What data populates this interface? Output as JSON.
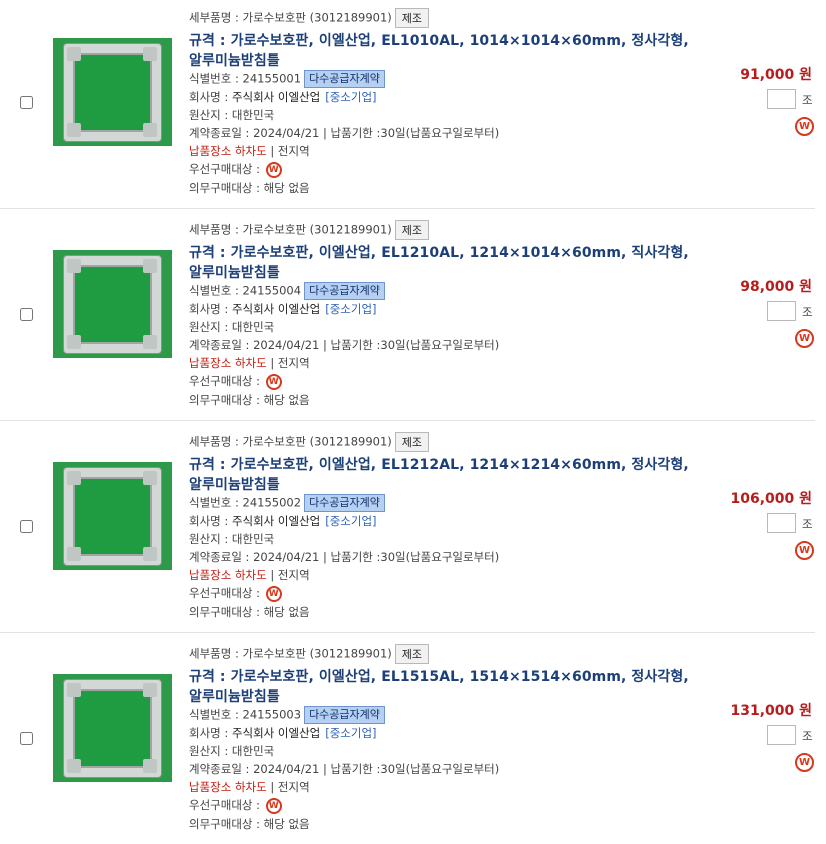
{
  "labels": {
    "sub_category": "세부품명 : 가로수보호판 (3012189901)",
    "mfr_badge": "제조",
    "id_prefix": "식별번호 : ",
    "multi_badge": "다수공급자계약",
    "company_prefix": "회사명 : ",
    "origin": "원산지 : 대한민국",
    "contract": "계약종료일 : 2024/04/21 | 납품기한 :30일(납품요구일로부터)",
    "delivery_place": "납품장소 하차도",
    "delivery_region": " | 전지역",
    "priority": "우선구매대상 : ",
    "mandatory": "의무구매대상 : 해당 없음",
    "qty_unit": "조",
    "w_mark": "W"
  },
  "items": [
    {
      "title": "규격 : 가로수보호판, 이엘산업, EL1010AL, 1014×1014×60mm, 정사각형, 알루미늄받침틀",
      "id": "24155001",
      "company": "주식회사 이엘산업",
      "sme": "[중소기업]",
      "price": "91,000 원"
    },
    {
      "title": "규격 : 가로수보호판, 이엘산업, EL1210AL, 1214×1014×60mm, 직사각형, 알루미늄받침틀",
      "id": "24155004",
      "company": "주식회사 이엘산업",
      "sme": "[중소기업]",
      "price": "98,000 원"
    },
    {
      "title": "규격 : 가로수보호판, 이엘산업, EL1212AL, 1214×1214×60mm, 정사각형, 알루미늄받침틀",
      "id": "24155002",
      "company": "주식회사 이엘산업",
      "sme": "[중소기업]",
      "price": "106,000 원"
    },
    {
      "title": "규격 : 가로수보호판, 이엘산업, EL1515AL, 1514×1514×60mm, 정사각형, 알루미늄받침틀",
      "id": "24155003",
      "company": "주식회사 이엘산업",
      "sme": "[중소기업]",
      "price": "131,000 원"
    }
  ]
}
